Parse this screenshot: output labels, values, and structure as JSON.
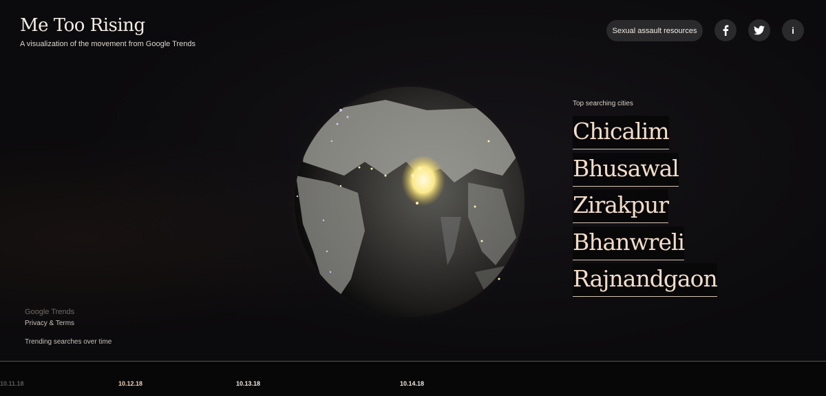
{
  "header": {
    "title": "Me Too Rising",
    "subtitle": "A visualization of the movement from Google Trends"
  },
  "actions": {
    "resources_label": "Sexual assault resources",
    "facebook_icon": "facebook-icon",
    "twitter_icon": "twitter-icon",
    "info_icon": "info-icon",
    "info_glyph": "i"
  },
  "cities": {
    "label": "Top searching cities",
    "items": [
      "Chicalim",
      "Bhusawal",
      "Zirakpur",
      "Bhanwreli",
      "Rajnandgaon"
    ]
  },
  "footer": {
    "google_trends": "Google Trends",
    "privacy": "Privacy & Terms",
    "trending": "Trending searches over time"
  },
  "timeline": {
    "dates": [
      "10.11.18",
      "10.12.18",
      "10.13.18",
      "10.14.18"
    ]
  },
  "colors": {
    "accent": "#f3dcc9",
    "background": "#0c0b0d",
    "glow": "#fff7b0"
  }
}
